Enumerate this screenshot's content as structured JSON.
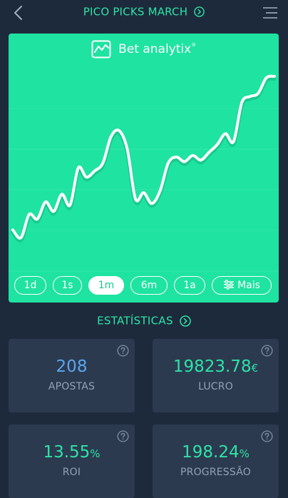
{
  "header": {
    "title": "PICO PICKS MARCH",
    "back_icon": "chevron-left-icon",
    "title_icon": "chevron-circle-right-icon",
    "menu_icon": "hamburger-menu-icon"
  },
  "chart_card": {
    "brand_name": "Bet analytix",
    "brand_mark": "®",
    "logo_icon": "line-chart-box-icon",
    "background": "#1ee3a1",
    "line_color": "#ffffff"
  },
  "chart_data": {
    "type": "line",
    "title": "",
    "xlabel": "",
    "ylabel": "",
    "grid": true,
    "legend": "none",
    "ylim": [
      0,
      100
    ],
    "values": [
      10,
      5,
      20,
      17,
      28,
      22,
      33,
      26,
      50,
      44,
      48,
      53,
      70,
      74,
      62,
      30,
      34,
      27,
      35,
      53,
      57,
      54,
      58,
      55,
      60,
      65,
      72,
      67,
      92,
      96,
      98,
      108,
      109
    ]
  },
  "range_buttons": [
    {
      "label": "1d",
      "active": false
    },
    {
      "label": "1s",
      "active": false
    },
    {
      "label": "1m",
      "active": true
    },
    {
      "label": "6m",
      "active": false
    },
    {
      "label": "1a",
      "active": false
    }
  ],
  "more_button": {
    "label": "Mais",
    "icon": "sliders-icon"
  },
  "stats_header": {
    "label": "ESTATÍSTICAS",
    "icon": "chevron-circle-right-icon"
  },
  "stats": [
    {
      "value": "208",
      "unit": "",
      "label": "APOSTAS",
      "color": "#5aa6ee"
    },
    {
      "value": "19823.78",
      "unit": "€",
      "label": "LUCRO",
      "color": "#2ee3a6"
    },
    {
      "value": "13.55",
      "unit": "%",
      "label": "ROI",
      "color": "#2ee3a6"
    },
    {
      "value": "198.24",
      "unit": "%",
      "label": "PROGRESSÃO",
      "color": "#2ee3a6"
    }
  ],
  "help_icon": "question-circle-icon"
}
